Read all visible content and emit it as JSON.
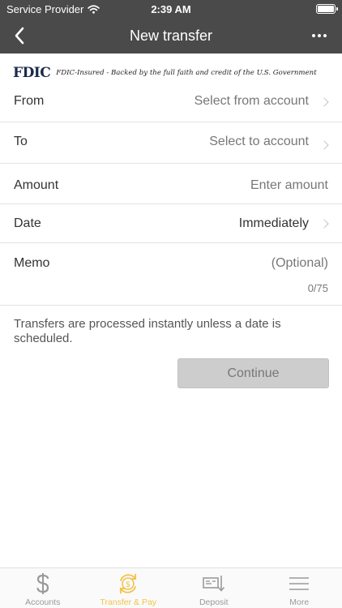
{
  "status_bar": {
    "carrier": "Service Provider",
    "time": "2:39 AM"
  },
  "nav": {
    "title": "New transfer"
  },
  "fdic": {
    "logo": "FDIC",
    "text": "FDIC-Insured - Backed by the full faith and credit of the U.S. Government"
  },
  "form": {
    "from": {
      "label": "From",
      "value": "Select from account"
    },
    "to": {
      "label": "To",
      "value": "Select to account"
    },
    "amount": {
      "label": "Amount",
      "placeholder": "Enter amount"
    },
    "date": {
      "label": "Date",
      "value": "Immediately"
    },
    "memo": {
      "label": "Memo",
      "placeholder": "(Optional)",
      "counter": "0/75"
    }
  },
  "info_text": "Transfers are processed instantly unless a date is scheduled.",
  "continue_label": "Continue",
  "tabs": [
    {
      "label": "Accounts",
      "icon": "dollar-icon"
    },
    {
      "label": "Transfer & Pay",
      "icon": "transfer-pay-icon",
      "active": true
    },
    {
      "label": "Deposit",
      "icon": "check-deposit-icon"
    },
    {
      "label": "More",
      "icon": "menu-icon"
    }
  ],
  "colors": {
    "header_bg": "#4a4a4a",
    "accent": "#f2c34a",
    "button_disabled": "#cdcdcd"
  }
}
